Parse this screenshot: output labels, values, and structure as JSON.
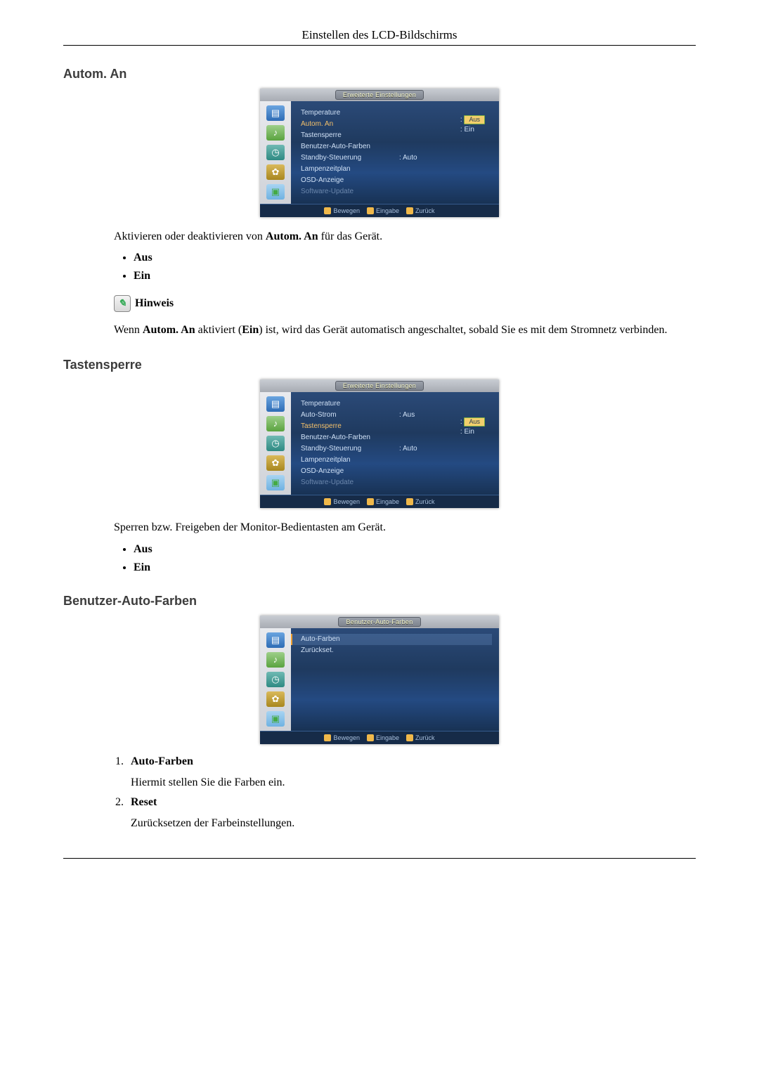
{
  "header": "Einstellen des LCD-Bildschirms",
  "sections": {
    "autom_an": {
      "title": "Autom. An",
      "osd": {
        "panel_title": "Erweiterte Einstellungen",
        "items": [
          {
            "label": "Temperature",
            "value": "",
            "dim": false,
            "hl": false
          },
          {
            "label": "Autom. An",
            "value": "",
            "dim": false,
            "hl": true
          },
          {
            "label": "Tastensperre",
            "value": "",
            "dim": false,
            "hl": false
          },
          {
            "label": "Benutzer-Auto-Farben",
            "value": "",
            "dim": false,
            "hl": false
          },
          {
            "label": "Standby-Steuerung",
            "value": ": Auto",
            "dim": false,
            "hl": false
          },
          {
            "label": "Lampenzeitplan",
            "value": "",
            "dim": false,
            "hl": false
          },
          {
            "label": "OSD-Anzeige",
            "value": "",
            "dim": false,
            "hl": false
          },
          {
            "label": "Software-Update",
            "value": "",
            "dim": true,
            "hl": false
          }
        ],
        "options": [
          {
            "text": "Aus",
            "selected": true
          },
          {
            "text": "Ein",
            "selected": false
          }
        ],
        "footer": {
          "move": "Bewegen",
          "enter": "Eingabe",
          "back": "Zurück"
        }
      },
      "desc_pre": "Aktivieren oder deaktivieren von ",
      "desc_bold": "Autom. An",
      "desc_post": " für das Gerät.",
      "opts": [
        "Aus",
        "Ein"
      ],
      "note_label": "Hinweis",
      "note_p1": "Wenn ",
      "note_b1": "Autom. An",
      "note_p2": " aktiviert (",
      "note_b2": "Ein",
      "note_p3": ") ist, wird das Gerät automatisch angeschaltet, sobald Sie es mit dem Stromnetz verbinden."
    },
    "tastensperre": {
      "title": "Tastensperre",
      "osd": {
        "panel_title": "Erweiterte Einstellungen",
        "items": [
          {
            "label": "Temperature",
            "value": "",
            "dim": false,
            "hl": false
          },
          {
            "label": "Auto-Strom",
            "value": ": Aus",
            "dim": false,
            "hl": false
          },
          {
            "label": "Tastensperre",
            "value": "",
            "dim": false,
            "hl": true
          },
          {
            "label": "Benutzer-Auto-Farben",
            "value": "",
            "dim": false,
            "hl": false
          },
          {
            "label": "Standby-Steuerung",
            "value": ": Auto",
            "dim": false,
            "hl": false
          },
          {
            "label": "Lampenzeitplan",
            "value": "",
            "dim": false,
            "hl": false
          },
          {
            "label": "OSD-Anzeige",
            "value": "",
            "dim": false,
            "hl": false
          },
          {
            "label": "Software-Update",
            "value": "",
            "dim": true,
            "hl": false
          }
        ],
        "options": [
          {
            "text": "Aus",
            "selected": true
          },
          {
            "text": "Ein",
            "selected": false
          }
        ],
        "footer": {
          "move": "Bewegen",
          "enter": "Eingabe",
          "back": "Zurück"
        }
      },
      "desc": "Sperren bzw. Freigeben der Monitor-Bedientasten am Gerät.",
      "opts": [
        "Aus",
        "Ein"
      ]
    },
    "benutzer_auto_farben": {
      "title": "Benutzer-Auto-Farben",
      "osd": {
        "panel_title": "Benutzer-Auto-Farben",
        "items": [
          {
            "label": "Auto-Farben",
            "value": "",
            "dim": false,
            "hl": false,
            "rowhl": true
          },
          {
            "label": "Zurückset.",
            "value": "",
            "dim": false,
            "hl": false
          }
        ],
        "footer": {
          "move": "Bewegen",
          "enter": "Eingabe",
          "back": "Zurück"
        }
      },
      "list": [
        {
          "title": "Auto-Farben",
          "desc": "Hiermit stellen Sie die Farben ein."
        },
        {
          "title": "Reset",
          "desc": "Zurücksetzen der Farbeinstellungen."
        }
      ]
    }
  },
  "colors": {
    "section_blue": "#3c3c3c"
  }
}
